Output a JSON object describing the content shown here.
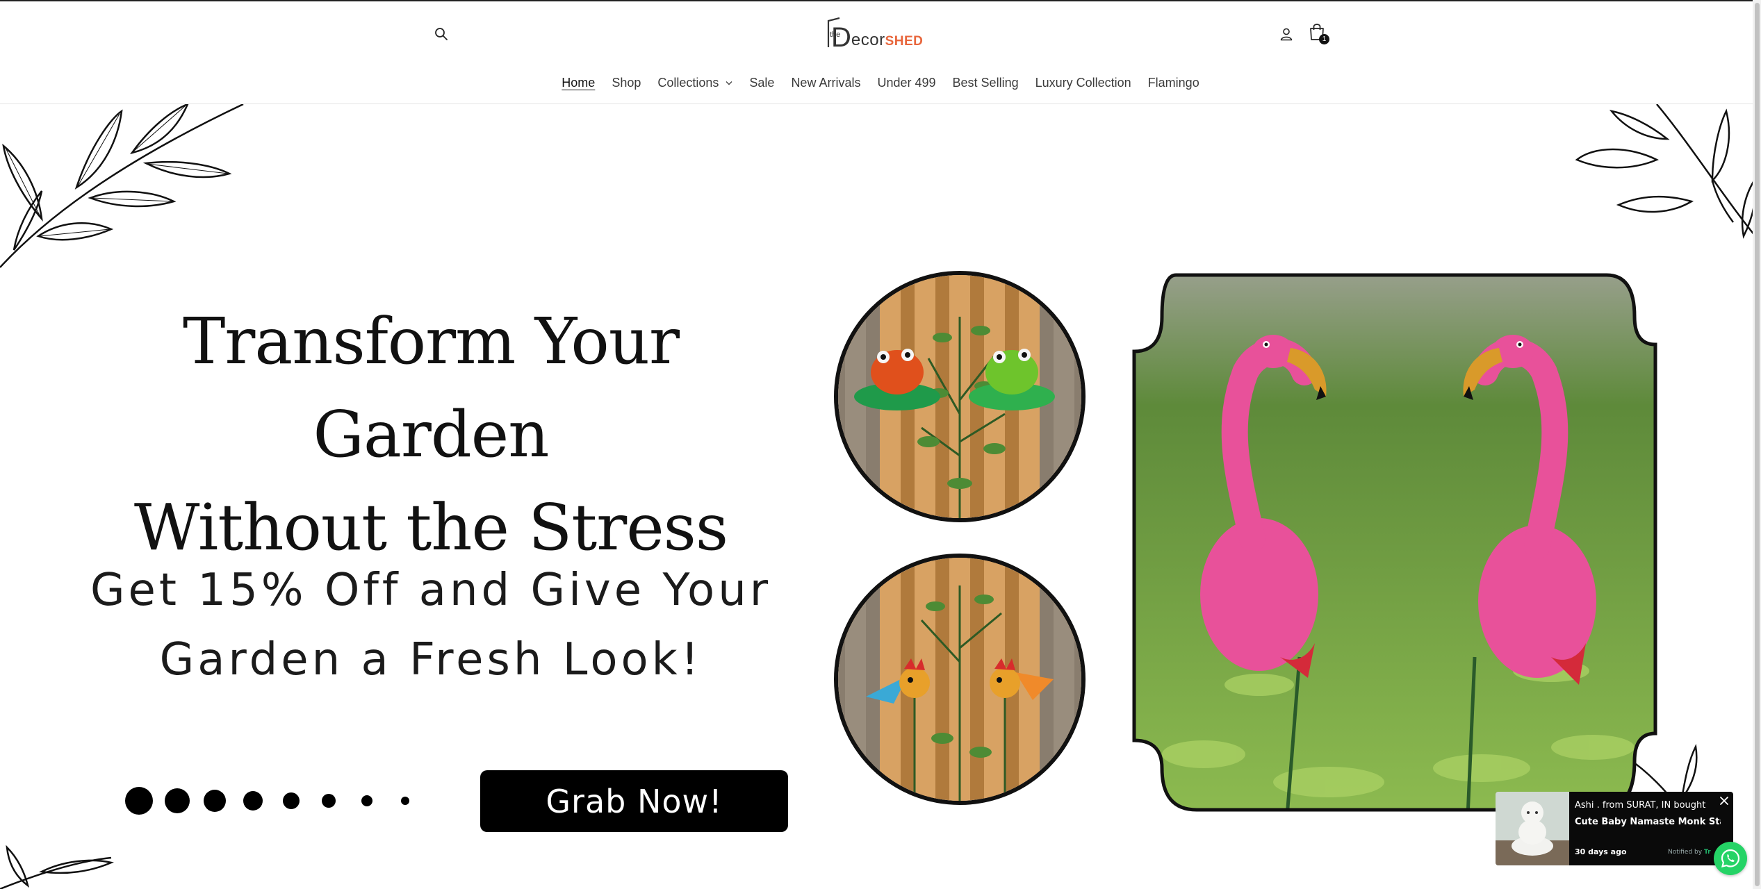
{
  "header": {
    "logo": {
      "prefix": "the",
      "letter": "D",
      "main": "ecor",
      "accent": "SHED"
    },
    "cart_count": "1",
    "icons": {
      "search": "search-icon",
      "account": "user-icon",
      "cart": "shopping-bag-icon"
    }
  },
  "nav": {
    "items": [
      {
        "label": "Home",
        "active": true
      },
      {
        "label": "Shop"
      },
      {
        "label": "Collections",
        "has_dropdown": true
      },
      {
        "label": "Sale"
      },
      {
        "label": "New Arrivals"
      },
      {
        "label": "Under 499"
      },
      {
        "label": "Best Selling"
      },
      {
        "label": "Luxury Collection"
      },
      {
        "label": "Flamingo"
      }
    ]
  },
  "hero": {
    "headline_line1": "Transform Your Garden",
    "headline_line2": "Without the Stress",
    "subline_line1": "Get 15% Off and Give Your",
    "subline_line2": "Garden a Fresh Look!",
    "cta_label": "Grab Now!"
  },
  "popup": {
    "line1": "Ashi . from SURAT, IN bought",
    "product": "Cute Baby Namaste Monk Stat...",
    "time": "30 days ago",
    "notified_prefix": "Notified by",
    "notified_brand": "Tr"
  },
  "colors": {
    "accent": "#e8663c",
    "flamingo": "#e8519a",
    "whatsapp": "#25d366"
  }
}
